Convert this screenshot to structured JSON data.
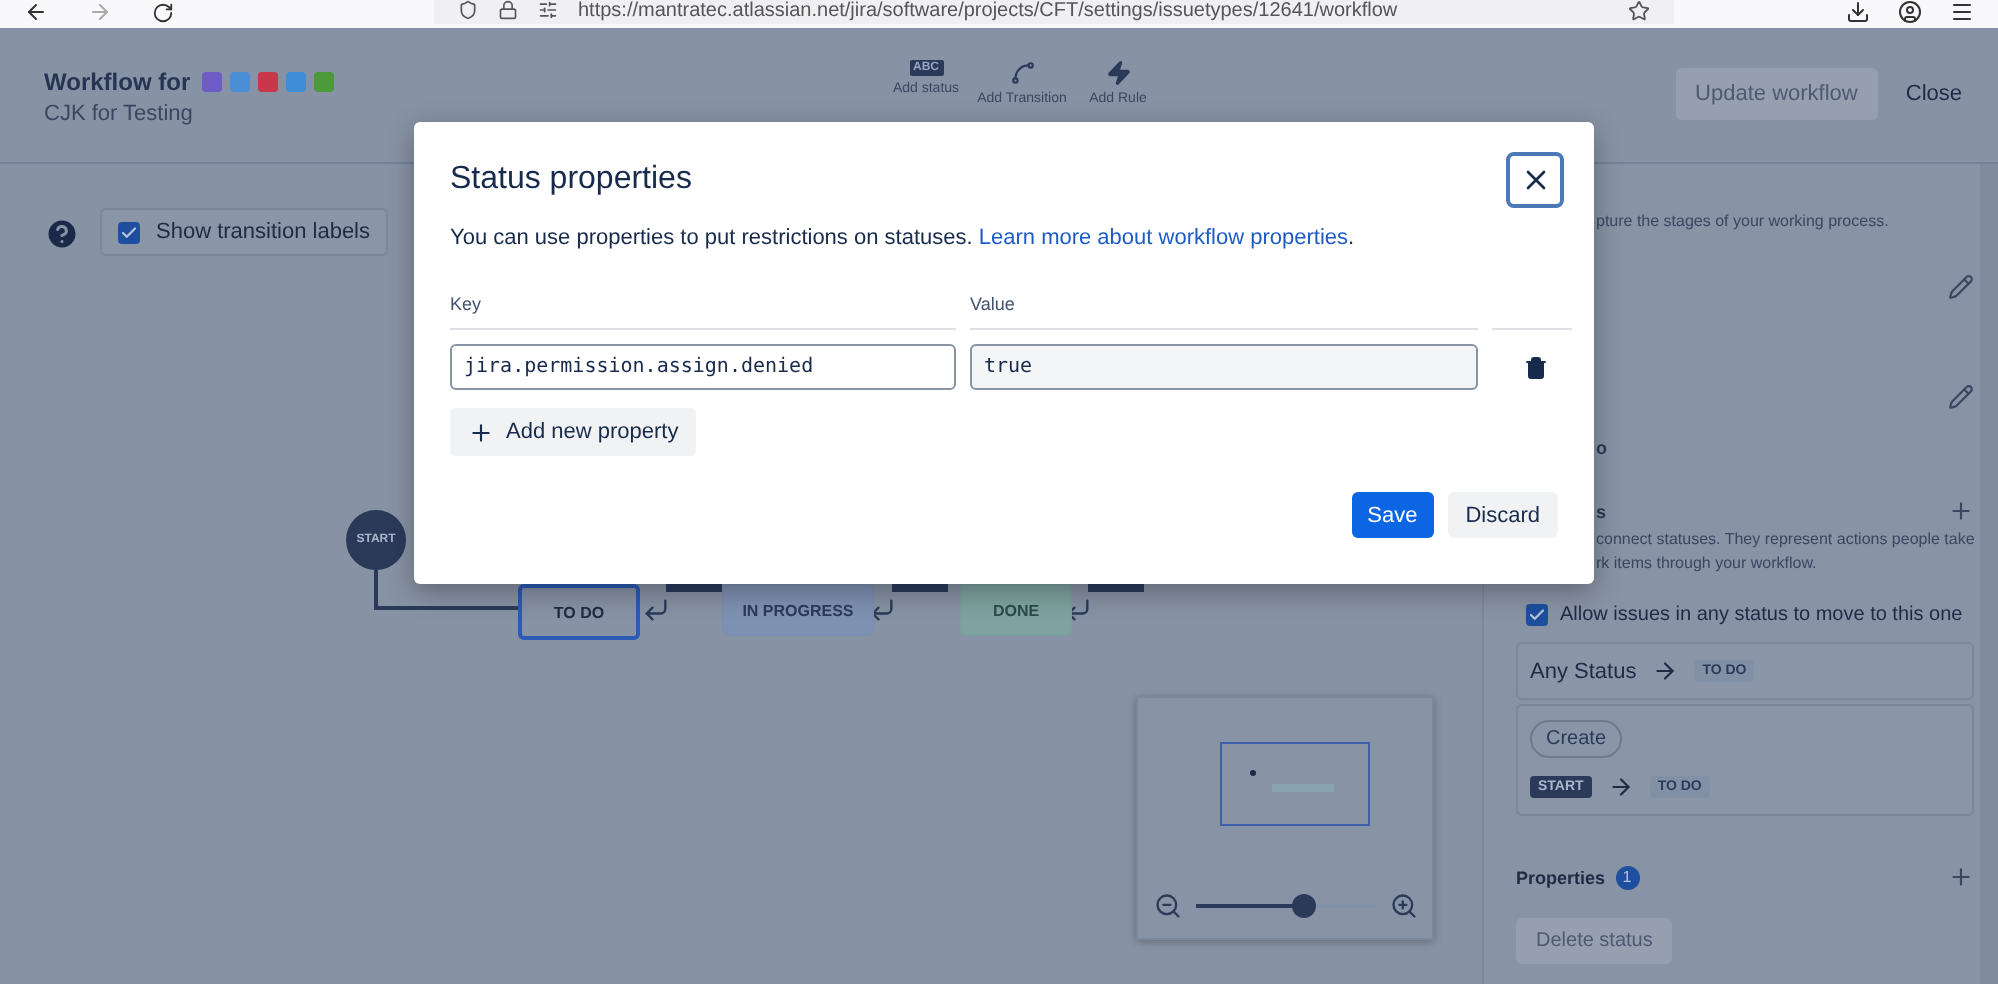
{
  "browser": {
    "url": "https://mantratec.atlassian.net/jira/software/projects/CFT/settings/issuetypes/12641/workflow"
  },
  "header": {
    "title": "Workflow for",
    "issue_types": [
      {
        "color": "#6e5dc6"
      },
      {
        "color": "#4a8fd6"
      },
      {
        "color": "#c9374a"
      },
      {
        "color": "#3d8ed6"
      },
      {
        "color": "#4c9a3a"
      }
    ],
    "project": "CJK for Testing",
    "toolbar": [
      {
        "kind": "status",
        "label": "Add status",
        "glyph": "ABC"
      },
      {
        "kind": "transition",
        "label": "Add Transition"
      },
      {
        "kind": "rule",
        "label": "Add Rule"
      }
    ],
    "update_button": {
      "label": "Update workflow",
      "disabled": true
    },
    "close_button": {
      "label": "Close"
    }
  },
  "canvas": {
    "show_labels": {
      "label": "Show transition labels",
      "checked": true
    },
    "nodes": [
      {
        "kind": "start",
        "label": "START",
        "selected": false
      },
      {
        "kind": "todo",
        "label": "TO DO",
        "selected": true
      },
      {
        "kind": "progress",
        "label": "IN PROGRESS",
        "selected": false
      },
      {
        "kind": "done",
        "label": "DONE",
        "selected": false
      }
    ],
    "minimap": {
      "level": 0.6
    }
  },
  "panel": {
    "description": "pture the stages of your working process.",
    "status_fragment": "o",
    "transitions_fragment": "s",
    "transitions_text": [
      "connect statuses. They represent actions people take",
      "rk items through your workflow."
    ],
    "allow_any": {
      "label": "Allow issues in any status to move to this one",
      "checked": true
    },
    "transitions": [
      {
        "kind": "global",
        "from": "Any Status",
        "to": "TO DO"
      },
      {
        "kind": "named",
        "name": "Create",
        "from": "START",
        "to": "TO DO"
      }
    ],
    "properties": {
      "label": "Properties",
      "count": "1"
    },
    "delete_button": {
      "label": "Delete status",
      "disabled": true
    }
  },
  "dialog": {
    "title": "Status properties",
    "intro": "You can use properties to put restrictions on statuses.",
    "link": "Learn more about workflow properties",
    "end": ".",
    "columns": [
      "Key",
      "Value"
    ],
    "rows": [
      {
        "key": "jira.permission.assign.denied",
        "value": "true"
      }
    ],
    "add_button": "Add new property",
    "save_button": "Save",
    "discard_button": "Discard"
  }
}
